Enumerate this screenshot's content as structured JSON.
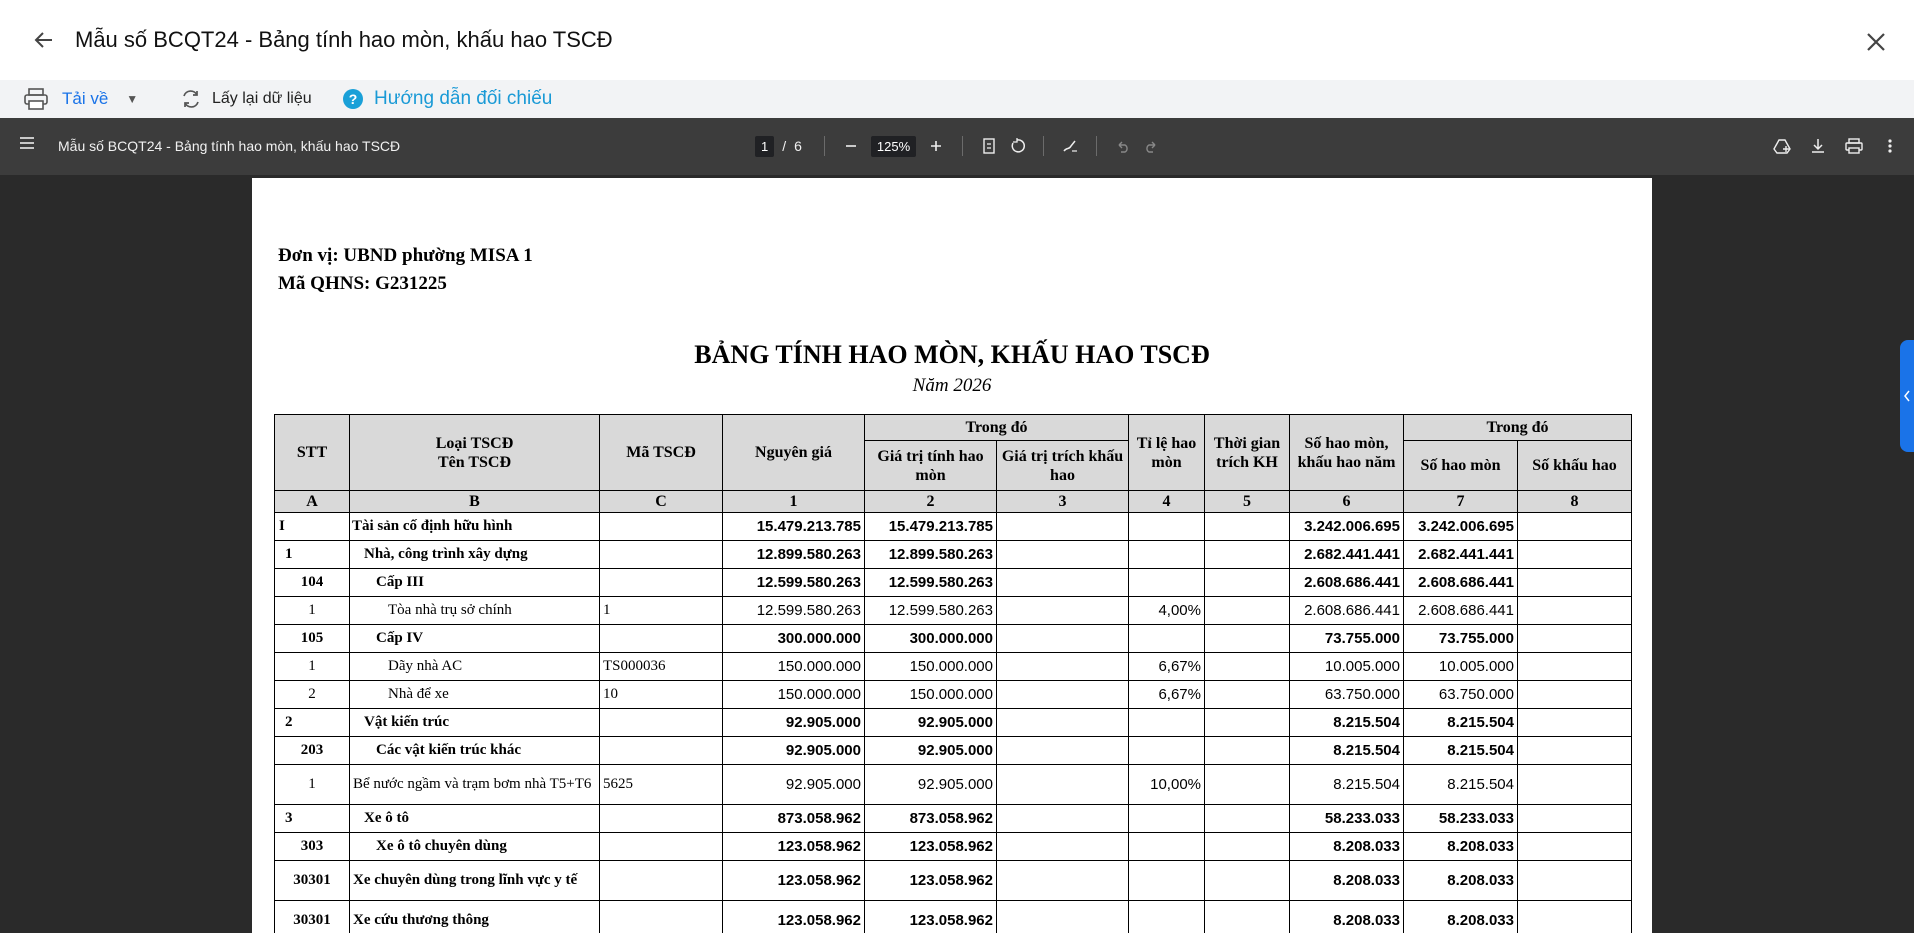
{
  "window": {
    "title": "Mẫu số BCQT24 - Bảng tính hao mòn, khấu hao TSCĐ"
  },
  "toolbar": {
    "download_label": "Tải về",
    "reload_label": "Lấy lại dữ liệu",
    "guide_label": "Hướng dẫn đối chiếu"
  },
  "pdf": {
    "doc_title": "Mẫu số BCQT24 - Bảng tính hao mòn, khấu hao TSCĐ",
    "page_current": "1",
    "page_sep": "/",
    "page_total": "6",
    "zoom": "125%"
  },
  "document": {
    "unit_line": "Đơn vị: UBND phường MISA 1",
    "qhns_line": "Mã QHNS: G231225",
    "title": "BẢNG TÍNH HAO MÒN, KHẤU HAO TSCĐ",
    "year": "Năm 2026",
    "headers": {
      "stt": "STT",
      "loai": "Loại TSCĐ",
      "ten": "Tên TSCĐ",
      "ma": "Mã TSCĐ",
      "nguyen_gia": "Nguyên giá",
      "trong_do_1": "Trong đó",
      "gt_hao_mon": "Giá trị tính hao mòn",
      "gt_khau_hao": "Giá trị trích khấu hao",
      "ti_le": "Tỉ lệ hao mòn",
      "thoi_gian": "Thời gian trích KH",
      "so_hao_mon_nam": "Số hao mòn, khấu hao năm",
      "trong_do_2": "Trong đó",
      "so_hao_mon": "Số hao mòn",
      "so_khau_hao": "Số khấu hao"
    },
    "codes": [
      "A",
      "B",
      "C",
      "1",
      "2",
      "3",
      "4",
      "5",
      "6",
      "7",
      "8"
    ],
    "rows": [
      {
        "stt": "I",
        "name": "Tài sản cố định hữu hình",
        "code": "",
        "ng": "15.479.213.785",
        "gthm": "15.479.213.785",
        "gtkh": "",
        "tl": "",
        "tg": "",
        "hmn": "3.242.006.695",
        "shm": "3.242.006.695",
        "skh": "",
        "bold": true,
        "indent": 0
      },
      {
        "stt": "1",
        "name": "Nhà, công trình xây dựng",
        "code": "",
        "ng": "12.899.580.263",
        "gthm": "12.899.580.263",
        "gtkh": "",
        "tl": "",
        "tg": "",
        "hmn": "2.682.441.441",
        "shm": "2.682.441.441",
        "skh": "",
        "bold": true,
        "indent": 1
      },
      {
        "stt": "104",
        "name": "Cấp III",
        "code": "",
        "ng": "12.599.580.263",
        "gthm": "12.599.580.263",
        "gtkh": "",
        "tl": "",
        "tg": "",
        "hmn": "2.608.686.441",
        "shm": "2.608.686.441",
        "skh": "",
        "bold": true,
        "indent": 2
      },
      {
        "stt": "1",
        "name": "Tòa nhà trụ sở chính",
        "code": "1",
        "ng": "12.599.580.263",
        "gthm": "12.599.580.263",
        "gtkh": "",
        "tl": "4,00%",
        "tg": "",
        "hmn": "2.608.686.441",
        "shm": "2.608.686.441",
        "skh": "",
        "bold": false,
        "indent": 3
      },
      {
        "stt": "105",
        "name": "Cấp IV",
        "code": "",
        "ng": "300.000.000",
        "gthm": "300.000.000",
        "gtkh": "",
        "tl": "",
        "tg": "",
        "hmn": "73.755.000",
        "shm": "73.755.000",
        "skh": "",
        "bold": true,
        "indent": 2
      },
      {
        "stt": "1",
        "name": "Dãy nhà AC",
        "code": "TS000036",
        "ng": "150.000.000",
        "gthm": "150.000.000",
        "gtkh": "",
        "tl": "6,67%",
        "tg": "",
        "hmn": "10.005.000",
        "shm": "10.005.000",
        "skh": "",
        "bold": false,
        "indent": 3
      },
      {
        "stt": "2",
        "name": "Nhà để xe",
        "code": "10",
        "ng": "150.000.000",
        "gthm": "150.000.000",
        "gtkh": "",
        "tl": "6,67%",
        "tg": "",
        "hmn": "63.750.000",
        "shm": "63.750.000",
        "skh": "",
        "bold": false,
        "indent": 3
      },
      {
        "stt": "2",
        "name": "Vật kiến trúc",
        "code": "",
        "ng": "92.905.000",
        "gthm": "92.905.000",
        "gtkh": "",
        "tl": "",
        "tg": "",
        "hmn": "8.215.504",
        "shm": "8.215.504",
        "skh": "",
        "bold": true,
        "indent": 1
      },
      {
        "stt": "203",
        "name": "Các vật kiến trúc khác",
        "code": "",
        "ng": "92.905.000",
        "gthm": "92.905.000",
        "gtkh": "",
        "tl": "",
        "tg": "",
        "hmn": "8.215.504",
        "shm": "8.215.504",
        "skh": "",
        "bold": true,
        "indent": 2
      },
      {
        "stt": "1",
        "name": "Bể nước ngầm và trạm bơm nhà T5+T6",
        "code": "5625",
        "ng": "92.905.000",
        "gthm": "92.905.000",
        "gtkh": "",
        "tl": "10,00%",
        "tg": "",
        "hmn": "8.215.504",
        "shm": "8.215.504",
        "skh": "",
        "bold": false,
        "indent": 3,
        "tall": true
      },
      {
        "stt": "3",
        "name": "Xe ô tô",
        "code": "",
        "ng": "873.058.962",
        "gthm": "873.058.962",
        "gtkh": "",
        "tl": "",
        "tg": "",
        "hmn": "58.233.033",
        "shm": "58.233.033",
        "skh": "",
        "bold": true,
        "indent": 1
      },
      {
        "stt": "303",
        "name": "Xe ô tô chuyên dùng",
        "code": "",
        "ng": "123.058.962",
        "gthm": "123.058.962",
        "gtkh": "",
        "tl": "",
        "tg": "",
        "hmn": "8.208.033",
        "shm": "8.208.033",
        "skh": "",
        "bold": true,
        "indent": 2
      },
      {
        "stt": "30301",
        "name": "Xe chuyên dùng trong lĩnh vực y tế",
        "code": "",
        "ng": "123.058.962",
        "gthm": "123.058.962",
        "gtkh": "",
        "tl": "",
        "tg": "",
        "hmn": "8.208.033",
        "shm": "8.208.033",
        "skh": "",
        "bold": true,
        "indent": 3,
        "tall": true
      },
      {
        "stt": "30301",
        "name": "Xe cứu thương thông",
        "code": "",
        "ng": "123.058.962",
        "gthm": "123.058.962",
        "gtkh": "",
        "tl": "",
        "tg": "",
        "hmn": "8.208.033",
        "shm": "8.208.033",
        "skh": "",
        "bold": true,
        "indent": 3,
        "tall": true
      }
    ]
  }
}
